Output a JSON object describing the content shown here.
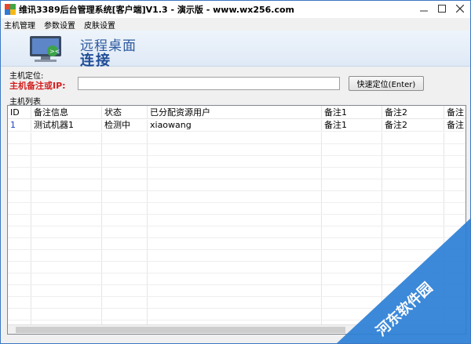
{
  "window": {
    "title": "维讯3389后台管理系统[客户端]V1.3 - 演示版 - www.wx256.com"
  },
  "menu": [
    "主机管理",
    "参数设置",
    "皮肤设置"
  ],
  "banner": {
    "line1": "远程桌面",
    "line2": "连接"
  },
  "locate": {
    "group_label": "主机定位:",
    "field_label": "主机备注或IP:",
    "value": "",
    "button_label": "快速定位(Enter)"
  },
  "list": {
    "group_label": "主机列表",
    "columns": [
      "ID",
      "备注信息",
      "状态",
      "已分配资源用户",
      "备注1",
      "备注2",
      "备注"
    ],
    "rows": [
      [
        "1",
        "测试机器1",
        "检测中",
        "xiaowang",
        "备注1",
        "备注2",
        "备注"
      ]
    ]
  },
  "watermark": {
    "text": "河东软件园"
  },
  "colors": {
    "accent": "#1f4c96",
    "label_red": "#d42020",
    "watermark_blue": "#2b7fd6"
  }
}
